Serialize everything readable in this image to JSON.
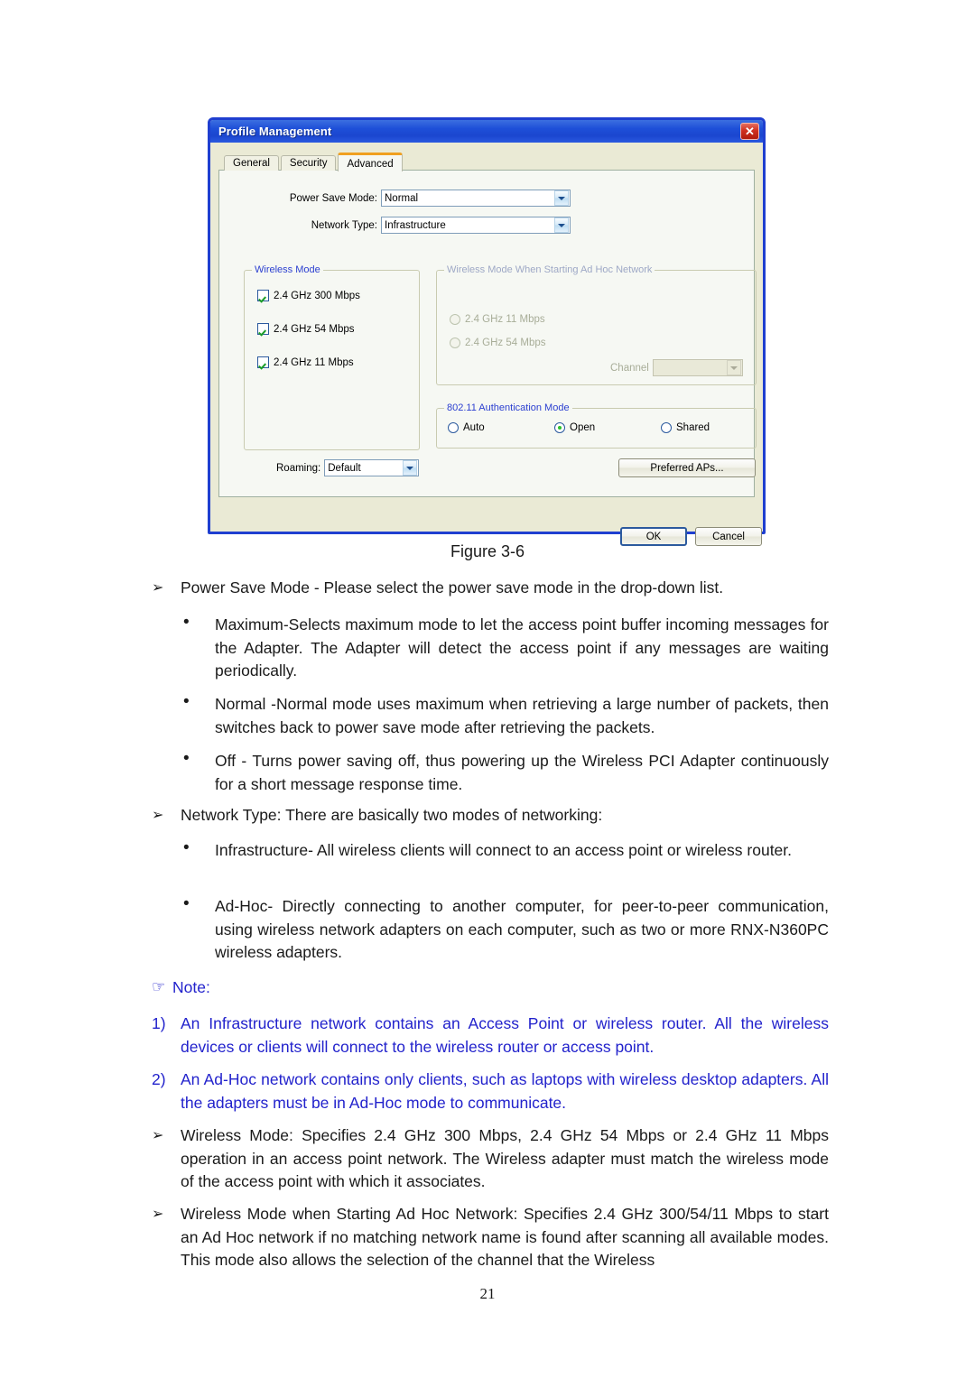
{
  "dialog": {
    "title": "Profile Management",
    "close_icon": "close-icon",
    "tabs": [
      {
        "label": "General",
        "active": false
      },
      {
        "label": "Security",
        "active": false
      },
      {
        "label": "Advanced",
        "active": true
      }
    ],
    "fields": [
      {
        "label": "Power Save Mode:",
        "value": "Normal"
      },
      {
        "label": "Network Type:",
        "value": "Infrastructure"
      }
    ],
    "wireless_mode_group": {
      "legend": "Wireless Mode",
      "options": [
        {
          "label": "2.4 GHz 300 Mbps",
          "checked": true
        },
        {
          "label": "2.4 GHz 54 Mbps",
          "checked": true
        },
        {
          "label": "2.4 GHz 11 Mbps",
          "checked": true
        }
      ]
    },
    "roaming": {
      "label": "Roaming:",
      "value": "Default"
    },
    "adhoc_group": {
      "legend": "Wireless Mode When Starting Ad Hoc Network",
      "disabled": true,
      "options": [
        {
          "label": "2.4 GHz 11 Mbps",
          "selected": false
        },
        {
          "label": "2.4 GHz 54 Mbps",
          "selected": false
        }
      ],
      "channel": {
        "label": "Channel",
        "value": ""
      }
    },
    "auth_group": {
      "legend": "802.11 Authentication Mode",
      "options": [
        {
          "label": "Auto",
          "selected": false
        },
        {
          "label": "Open",
          "selected": true
        },
        {
          "label": "Shared",
          "selected": false
        }
      ]
    },
    "preferred_aps_button": "Preferred APs...",
    "ok_button": "OK",
    "cancel_button": "Cancel",
    "accent_titlebar": "#1e4fd8",
    "accent_active_tab": "#f0a020",
    "accent_legend": "#2b3fd0"
  },
  "document": {
    "figure_caption": "Figure 3-6",
    "markers": {
      "arrow": "➢",
      "bullet": "•",
      "hand": "☞"
    },
    "blocks": [
      {
        "marker": "arrow",
        "text": "Power Save Mode - Please select the power save mode in the drop-down list."
      },
      {
        "marker": "bullet",
        "text": "Maximum-Selects maximum mode to let the access point buffer incoming messages for the Adapter. The Adapter will detect the access point if any messages are waiting periodically."
      },
      {
        "marker": "bullet",
        "text": "Normal -Normal mode uses maximum when retrieving a large number of packets, then switches back to power save mode after retrieving the packets."
      },
      {
        "marker": "bullet",
        "text": "Off - Turns power saving off, thus powering up the Wireless PCI Adapter continuously for a short message response time."
      },
      {
        "marker": "arrow",
        "text": "Network Type: There are basically two modes of networking:"
      },
      {
        "marker": "bullet",
        "text": "Infrastructure- All wireless clients will connect to an access point or wireless router."
      },
      {
        "marker": "bullet",
        "text": "Ad-Hoc- Directly connecting to another computer, for peer-to-peer communication, using wireless network adapters on each computer, such as two or more RNX-N360PC wireless adapters."
      }
    ],
    "note": {
      "title": "Note:",
      "items": [
        {
          "number": "1)",
          "text": "An Infrastructure network contains an Access Point or wireless router. All the wireless devices or clients will connect to the wireless router or access point."
        },
        {
          "number": "2)",
          "text": "An Ad-Hoc network contains only clients, such as laptops with wireless desktop adapters. All the adapters must be in Ad-Hoc mode to communicate."
        }
      ],
      "color": "#2222cc"
    },
    "tail_blocks": [
      {
        "marker": "arrow",
        "text": "Wireless Mode: Specifies 2.4 GHz 300 Mbps, 2.4 GHz 54 Mbps or 2.4 GHz 11 Mbps operation in an access point network. The Wireless adapter must match the wireless mode of the access point with which it associates."
      },
      {
        "marker": "arrow",
        "text": "Wireless Mode when Starting Ad Hoc Network: Specifies 2.4 GHz 300/54/11 Mbps to start an Ad Hoc network if no matching network name is found after scanning all available modes. This mode also allows the selection of the channel that the Wireless"
      }
    ],
    "page_number": "21"
  }
}
